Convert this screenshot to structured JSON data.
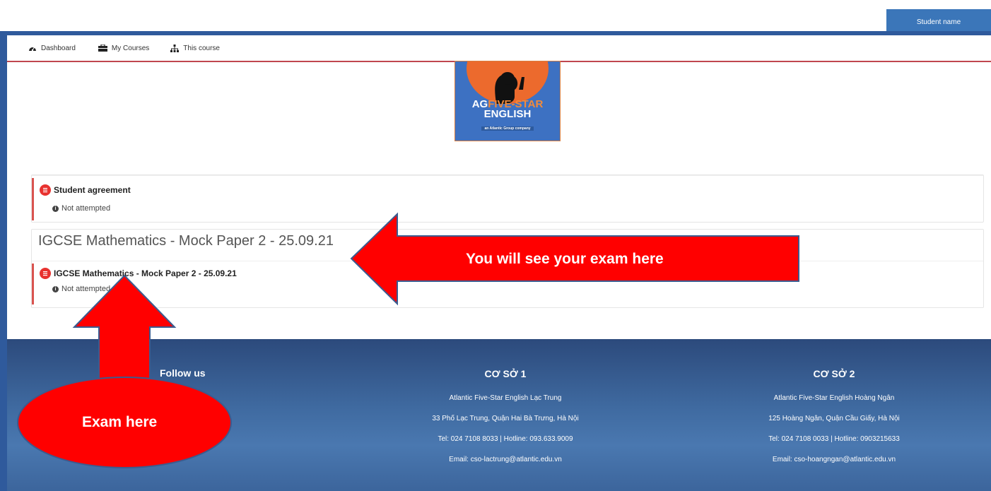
{
  "user": {
    "name": "Student name"
  },
  "nav": {
    "items": [
      {
        "label": "Dashboard",
        "icon": "dashboard-icon"
      },
      {
        "label": "My Courses",
        "icon": "briefcase-icon"
      },
      {
        "label": "This course",
        "icon": "sitemap-icon"
      }
    ]
  },
  "logo": {
    "line1": "FIVE-STAR",
    "line2": "ENGLISH",
    "tagline": "an Atlantic Group company",
    "prefix": "AG"
  },
  "sections": [
    {
      "title": "",
      "activity": {
        "name": "Student agreement",
        "status": "Not attempted"
      }
    },
    {
      "title": "IGCSE Mathematics - Mock Paper 2 - 25.09.21",
      "activity": {
        "name": "IGCSE Mathematics - Mock Paper 2 - 25.09.21",
        "status": "Not attempted"
      }
    }
  ],
  "annotations": {
    "arrow_left_text": "You will see your exam here",
    "ellipse_text": "Exam here",
    "color": "#ff0000"
  },
  "footer": {
    "follow": "Follow us",
    "branch1": {
      "title": "CƠ SỞ 1",
      "name": "Atlantic Five-Star English Lạc Trung",
      "address": "33 Phố Lạc Trung, Quận Hai Bà Trưng, Hà Nội",
      "tel": "Tel: 024 7108 8033 | Hotline: 093.633.9009",
      "email": "Email: cso-lactrung@atlantic.edu.vn"
    },
    "branch2": {
      "title": "CƠ SỞ 2",
      "name": "Atlantic Five-Star English Hoàng Ngân",
      "address": "125 Hoàng Ngân, Quận Cầu Giấy, Hà Nội",
      "tel": "Tel: 024 7108 0033 | Hotline: 0903215633",
      "email": "Email: cso-hoangngan@atlantic.edu.vn"
    }
  }
}
